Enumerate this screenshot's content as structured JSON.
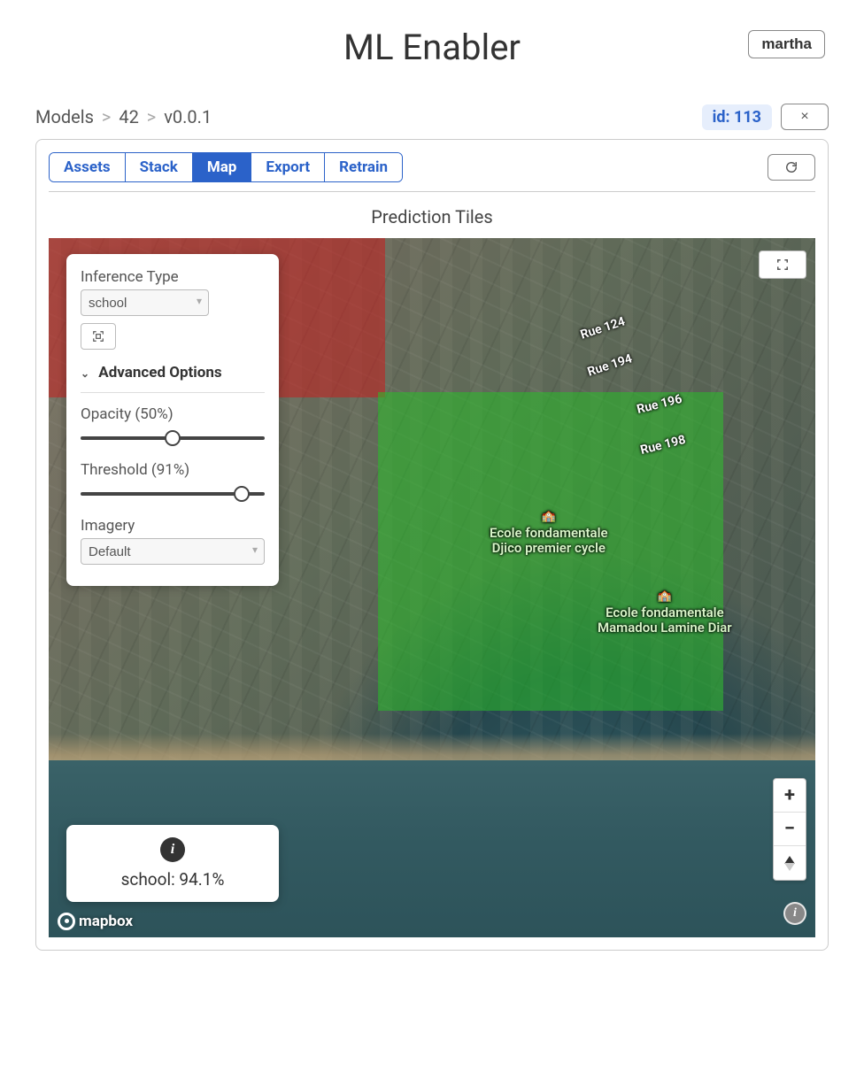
{
  "header": {
    "title": "ML Enabler",
    "user": "martha"
  },
  "breadcrumb": {
    "root": "Models",
    "model_id": "42",
    "version": "v0.0.1",
    "sep": ">"
  },
  "prediction": {
    "id_label": "id: 113"
  },
  "tabs": {
    "items": [
      "Assets",
      "Stack",
      "Map",
      "Export",
      "Retrain"
    ],
    "active_index": 2
  },
  "section": {
    "title": "Prediction Tiles"
  },
  "controls": {
    "inference_type_label": "Inference Type",
    "inference_type_value": "school",
    "advanced_label": "Advanced Options",
    "opacity_label": "Opacity (50%)",
    "opacity_value": 50,
    "threshold_label": "Threshold (91%)",
    "threshold_value": 91,
    "imagery_label": "Imagery",
    "imagery_value": "Default"
  },
  "tile_info": {
    "text": "school: 94.1%"
  },
  "map": {
    "attribution": "mapbox",
    "streets": [
      "Rue 124",
      "Rue 194",
      "Rue 196",
      "Rue 198"
    ],
    "pois": [
      {
        "name": "Ecole fondamentale\nDjico premier cycle"
      },
      {
        "name": "Ecole fondamentale\nMamadou Lamine Diar"
      }
    ],
    "tiles": [
      {
        "class": "negative",
        "color": "#c81e1e"
      },
      {
        "class": "positive",
        "color": "#28be28"
      }
    ]
  }
}
